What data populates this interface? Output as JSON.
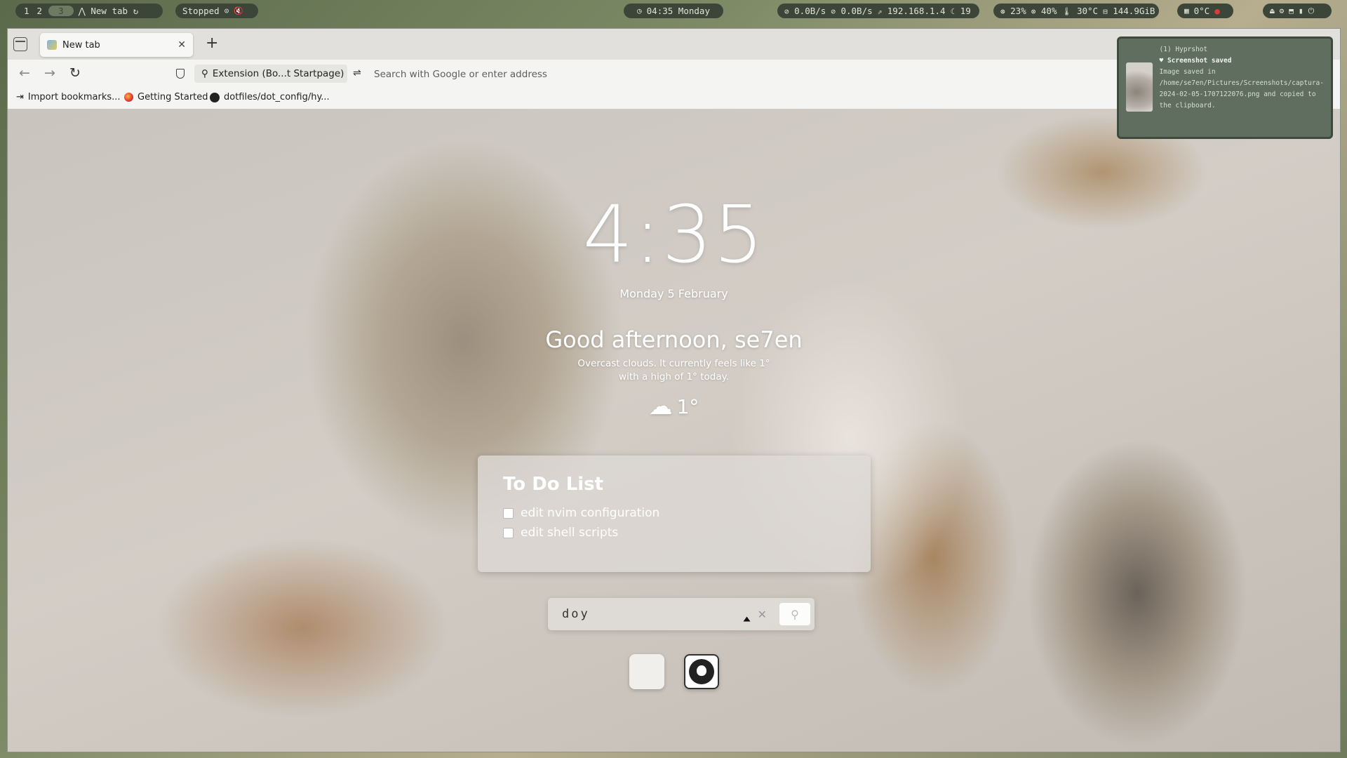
{
  "statusbar": {
    "workspaces": [
      "1",
      "2",
      "3"
    ],
    "active_workspace": "3",
    "window_title": "New tab",
    "player": "Stopped",
    "clock": "04:35 Monday",
    "net_up": "0.0B/s",
    "net_down": "0.0B/s",
    "ip": "192.168.1.4",
    "updates": "19",
    "cpu": "23%",
    "mem": "40%",
    "temp": "30°C",
    "disk": "144.9GiB",
    "weather_temp": "0°C"
  },
  "browser": {
    "tab_title": "New tab",
    "tab_close": "✕",
    "new_tab": "+",
    "extension_chip": "Extension (Bo...t Startpage)",
    "url_placeholder": "Search with Google or enter address",
    "bookmarks": [
      "Import bookmarks...",
      "Getting Started",
      "dotfiles/dot_config/hy..."
    ]
  },
  "startpage": {
    "clock": "4:35",
    "date": "Monday 5 February",
    "greeting": "Good afternoon, se7en",
    "weather_line1": "Overcast clouds. It currently feels like 1°",
    "weather_line2": "with a high of 1° today.",
    "weather_temp": "1°",
    "todo_title": "To Do List",
    "todo_items": [
      "edit nvim configuration",
      "edit shell scripts"
    ],
    "search_value": "doy",
    "search_clear": "✕"
  },
  "notification": {
    "header": "(1) Hyprshot",
    "title": "Screenshot saved",
    "body": "Image saved in /home/se7en/Pictures/Screenshots/captura-2024-02-05-1707122076.png and copied to the clipboard."
  }
}
